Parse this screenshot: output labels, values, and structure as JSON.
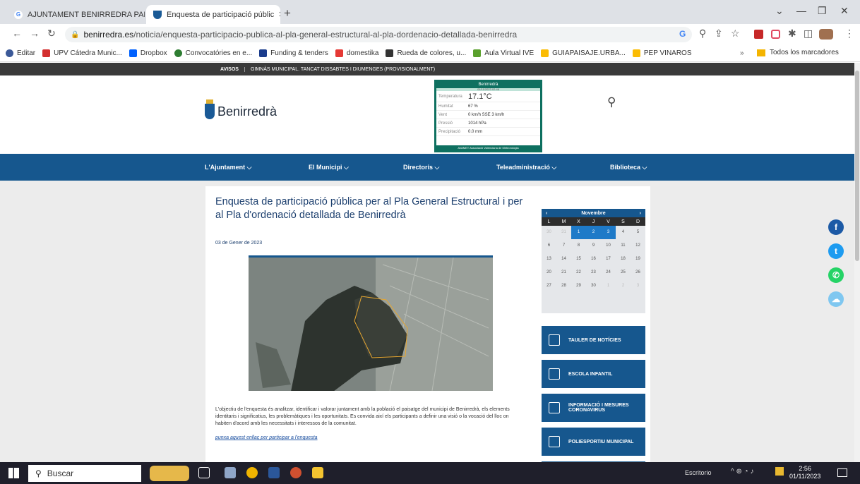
{
  "browser": {
    "tabs": [
      {
        "title": "AJUNTAMENT BENIRREDRA PAR",
        "favicon": "G"
      },
      {
        "title": "Enquesta de participació públic",
        "favicon": "shield"
      }
    ],
    "new_tab": "+",
    "url_domain": "benirredra.es",
    "url_path": "/noticia/enquesta-participacio-publica-al-pla-general-estructural-al-pla-dordenacio-detallada-benirredra",
    "bookmarks": [
      "Editar",
      "UPV Cátedra Munic...",
      "Dropbox",
      "Convocatóries en e...",
      "Funding & tenders",
      "domestika",
      "Rueda de colores, u...",
      "Aula Virtual IVE",
      "GUIAPAISAJE.URBA...",
      "PEP VINAROS"
    ],
    "bookmarks_more": "»",
    "all_bookmarks": "Todos los marcadores"
  },
  "site": {
    "avisos_label": "AVISOS",
    "avisos_text": "GIMNÀS MUNICIPAL. TANCAT DISSABTES I DIUMENGES (PROVISIONALMENT)",
    "logo_text": "Benirredrà",
    "weather": {
      "title": "Benirredrà",
      "date": "01/11/2023 02:46",
      "rows": [
        {
          "label": "Temperatura",
          "value": "17.1°C"
        },
        {
          "label": "Humitat",
          "value": "67 %"
        },
        {
          "label": "Vent",
          "value": "0 km/h SSE 3 km/h"
        },
        {
          "label": "Pressió",
          "value": "1014 hPa"
        },
        {
          "label": "Precipitació",
          "value": "0.0 mm"
        }
      ],
      "footer": "AVAMET Associació Valenciana de Meteorologia"
    },
    "menu": [
      "L'Ajuntament ⌵",
      "El Municipi ⌵",
      "Directoris ⌵",
      "Teleadministració ⌵",
      "Biblioteca ⌵"
    ]
  },
  "article": {
    "title": "Enquesta de participació pública per al Pla General Estructural i per al Pla d'ordenació detallada de Benirredrà",
    "date": "03 de Gener de 2023",
    "description": "L'objectiu de l'enquesta és analitzar, identificar i valorar juntament amb la població el paisatge del municipi de Benirredrà, els elements identitaris i significatius, les problemàtiques i les oportunitats. Es convida així els participants a definir una visió o la vocació del lloc on habiten d'acord amb les necessitats i interessos de la comunitat.",
    "link": "punxa aquest enllaç per participar a l'enquesta"
  },
  "calendar": {
    "month": "Novembre",
    "prev": "‹",
    "next": "›",
    "dow": [
      "L",
      "M",
      "X",
      "J",
      "V",
      "S",
      "D"
    ],
    "days": [
      "30",
      "31",
      "1",
      "2",
      "3",
      "4",
      "5",
      "6",
      "7",
      "8",
      "9",
      "10",
      "11",
      "12",
      "13",
      "14",
      "15",
      "16",
      "17",
      "18",
      "19",
      "20",
      "21",
      "22",
      "23",
      "24",
      "25",
      "26",
      "27",
      "28",
      "29",
      "30",
      "1",
      "2",
      "3"
    ]
  },
  "quick_links": [
    "TAULER DE NOTÍCIES",
    "ESCOLA INFANTIL",
    "INFORMACIÓ I MESURES CORONAVIRUS",
    "POLIESPORTIU MUNICIPAL"
  ],
  "taskbar": {
    "search": "Buscar",
    "escritorio": "Escritorio",
    "time": "2:56",
    "date": "01/11/2023"
  }
}
